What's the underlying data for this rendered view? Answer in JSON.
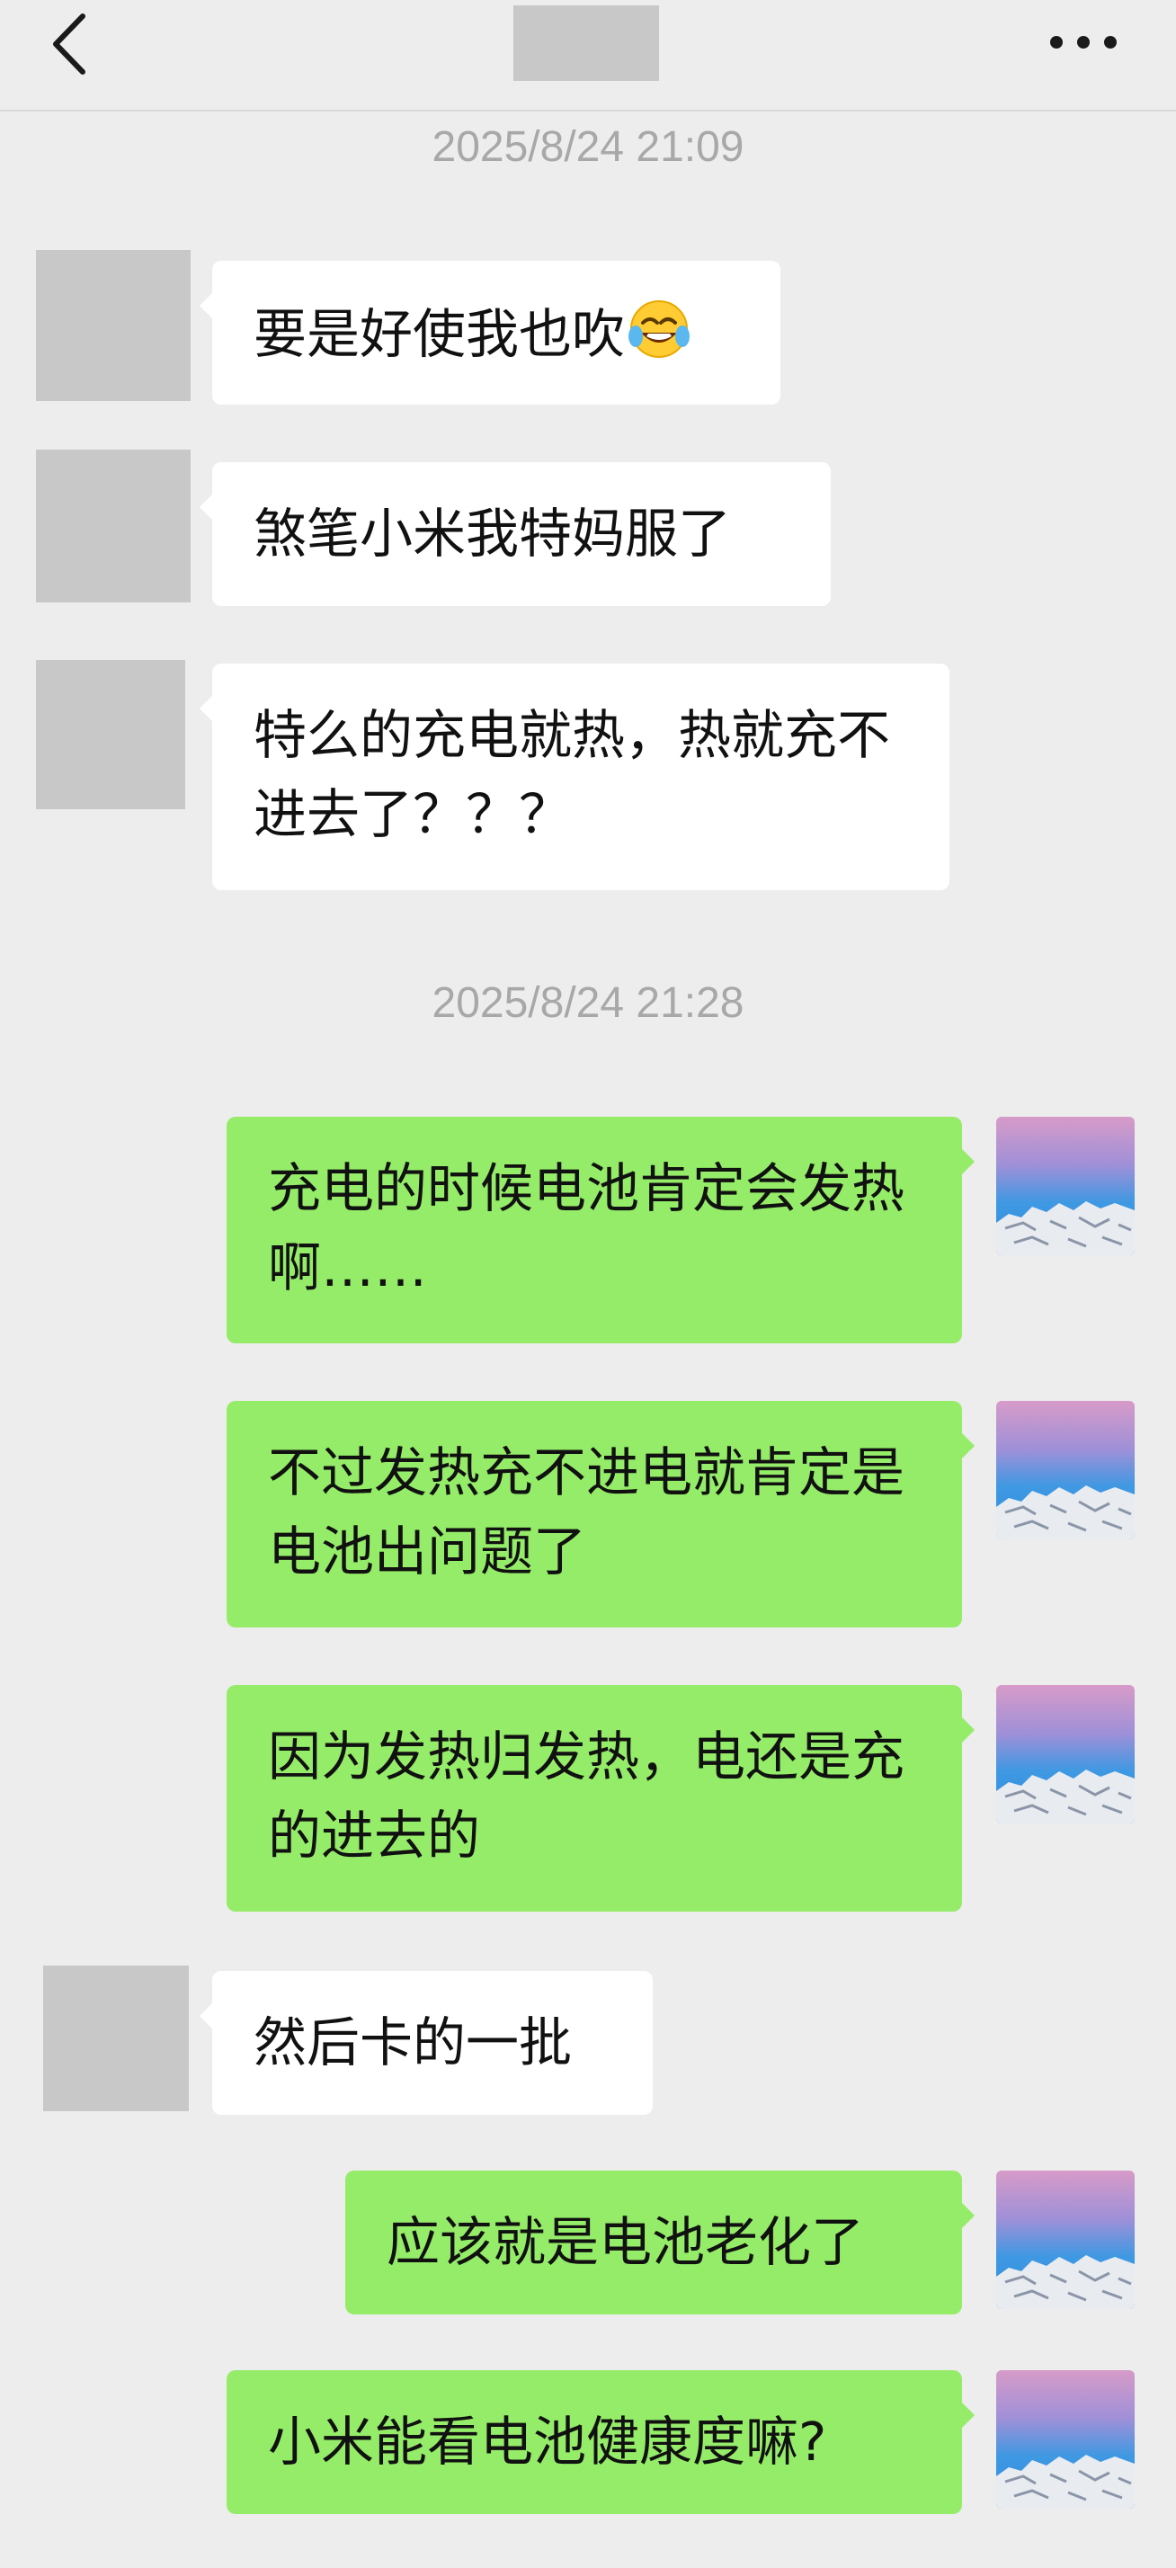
{
  "header": {
    "back_icon": "chevron-left-icon",
    "more_icon": "ellipsis-icon"
  },
  "timestamps": [
    "2025/8/24  21:09",
    "2025/8/24  21:28"
  ],
  "messages": [
    {
      "side": "in",
      "text": "要是好使我也吹",
      "emoji": "tears-of-joy-emoji"
    },
    {
      "side": "in",
      "text": "煞笔小米我特妈服了"
    },
    {
      "side": "in",
      "text": "特么的充电就热，热就充不进去了？？？"
    },
    {
      "side": "out",
      "text": "充电的时候电池肯定会发热啊……"
    },
    {
      "side": "out",
      "text": "不过发热充不进电就肯定是电池出问题了"
    },
    {
      "side": "out",
      "text": "因为发热归发热，电还是充的进去的"
    },
    {
      "side": "in",
      "text": "然后卡的一批"
    },
    {
      "side": "out",
      "text": "应该就是电池老化了"
    },
    {
      "side": "out",
      "text": "小米能看电池健康度嘛?"
    }
  ],
  "colors": {
    "background": "#ededed",
    "incoming_bubble": "#ffffff",
    "outgoing_bubble": "#95ec69",
    "timestamp_text": "#a8a8a8",
    "placeholder_avatar": "#c8c8c8"
  }
}
